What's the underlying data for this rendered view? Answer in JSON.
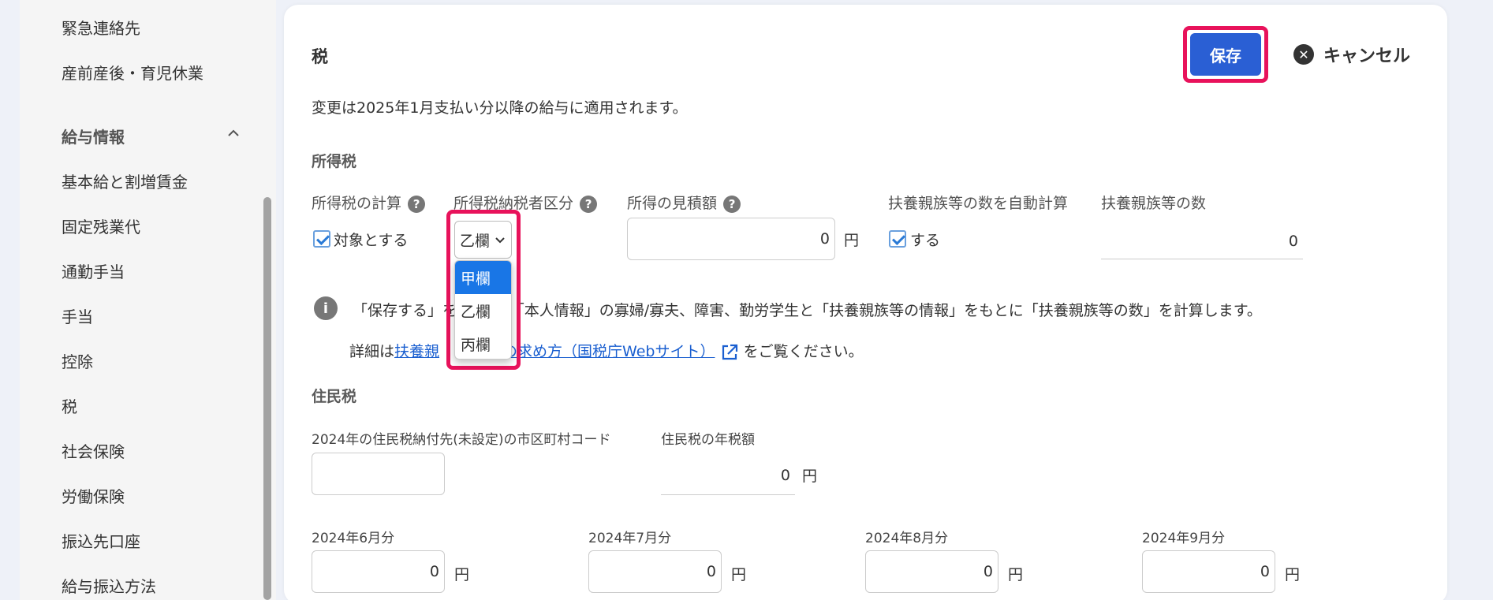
{
  "sidebar": {
    "items_top": [
      "緊急連絡先",
      "産前産後・育児休業"
    ],
    "group_label": "給与情報",
    "items": [
      "基本給と割増賃金",
      "固定残業代",
      "通勤手当",
      "手当",
      "控除",
      "税",
      "社会保険",
      "労働保険",
      "振込先口座",
      "給与振込方法"
    ]
  },
  "header": {
    "title": "税",
    "save_label": "保存",
    "cancel_label": "キャンセル"
  },
  "notice": "変更は2025年1月支払い分以降の給与に適用されます。",
  "income_tax": {
    "section_title": "所得税",
    "calc_label": "所得税の計算",
    "calc_checkbox_label": "対象とする",
    "category_label": "所得税納税者区分",
    "category_value": "乙欄",
    "category_options": [
      "甲欄",
      "乙欄",
      "丙欄"
    ],
    "category_selected_option": "甲欄",
    "estimate_label": "所得の見積額",
    "estimate_value": "0",
    "unit": "円",
    "auto_calc_label": "扶養親族等の数を自動計算",
    "auto_calc_checkbox_label": "する",
    "dependents_label": "扶養親族等の数",
    "dependents_value": "0",
    "info_line1_a": "「保存する」を",
    "info_line1_b": "押すと、「本人情報」の寡婦/寡夫、障害、勤労学生と「扶養親族等の情報」をもとに「扶養親族等の数」を計算します。",
    "info_line2_prefix": "詳細は",
    "info_link_a": "扶養親",
    "info_link_b": "の求め方（国税庁Webサイト）",
    "info_line2_suffix": "をご覧ください。"
  },
  "resident_tax": {
    "section_title": "住民税",
    "code_label": "2024年の住民税納付先(未設定)の市区町村コード",
    "code_value": "",
    "annual_label": "住民税の年税額",
    "annual_value": "0",
    "unit": "円",
    "months": [
      {
        "label": "2024年6月分",
        "value": "0"
      },
      {
        "label": "2024年7月分",
        "value": "0"
      },
      {
        "label": "2024年8月分",
        "value": "0"
      },
      {
        "label": "2024年9月分",
        "value": "0"
      }
    ]
  },
  "colors": {
    "accent": "#2a5fd4",
    "highlight": "#e8125b",
    "selected_option": "#1976e6",
    "link": "#1a5fd0"
  },
  "icons": [
    "chevron-up-icon",
    "help-icon",
    "checkbox-checked-icon",
    "chevron-down-icon",
    "info-icon",
    "external-link-icon",
    "close-circle-icon"
  ]
}
